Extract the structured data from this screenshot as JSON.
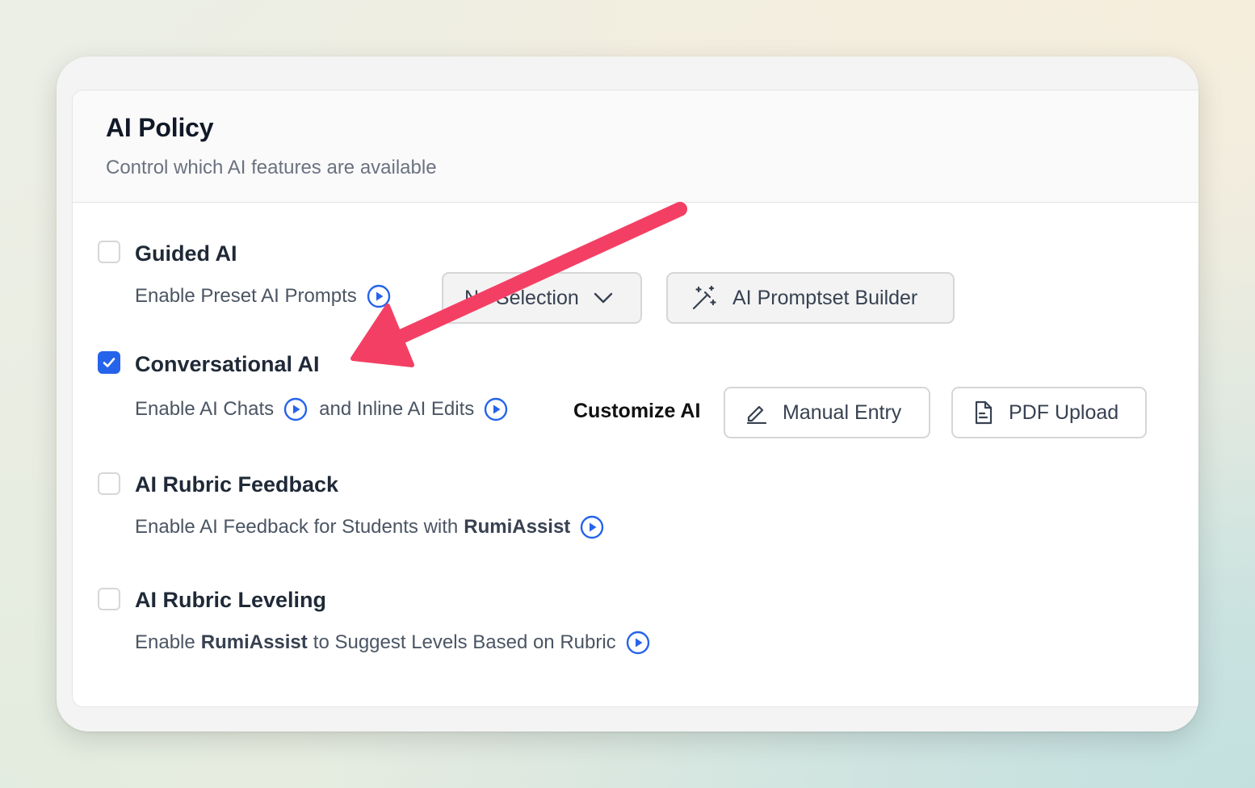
{
  "policy": {
    "title": "AI Policy",
    "subtitle": "Control which AI features are available"
  },
  "options": {
    "guided": {
      "title": "Guided AI",
      "checked": false,
      "description": "Enable Preset AI Prompts",
      "select_value": "No Selection",
      "builder_label": "AI Promptset Builder"
    },
    "conversational": {
      "title": "Conversational AI",
      "checked": true,
      "desc_part1": "Enable AI Chats",
      "desc_part2": "and Inline AI Edits",
      "customize_label": "Customize AI",
      "manual_entry_label": "Manual Entry",
      "pdf_upload_label": "PDF Upload"
    },
    "rubric_feedback": {
      "title": "AI Rubric Feedback",
      "checked": false,
      "desc_prefix": "Enable AI Feedback for Students with",
      "desc_brand": "RumiAssist"
    },
    "rubric_leveling": {
      "title": "AI Rubric Leveling",
      "checked": false,
      "desc_prefix": "Enable",
      "desc_brand": "RumiAssist",
      "desc_suffix": "to Suggest Levels Based on Rubric"
    }
  },
  "icons": {
    "play": "play-circle-icon",
    "chevron": "chevron-down-icon",
    "wand": "magic-wand-icon",
    "pencil": "pencil-icon",
    "document": "document-icon",
    "check": "check-icon"
  },
  "colors": {
    "accent": "#2563eb",
    "annotation_arrow": "#f43f64",
    "text_primary": "#1f2937",
    "text_secondary": "#4b5563"
  }
}
